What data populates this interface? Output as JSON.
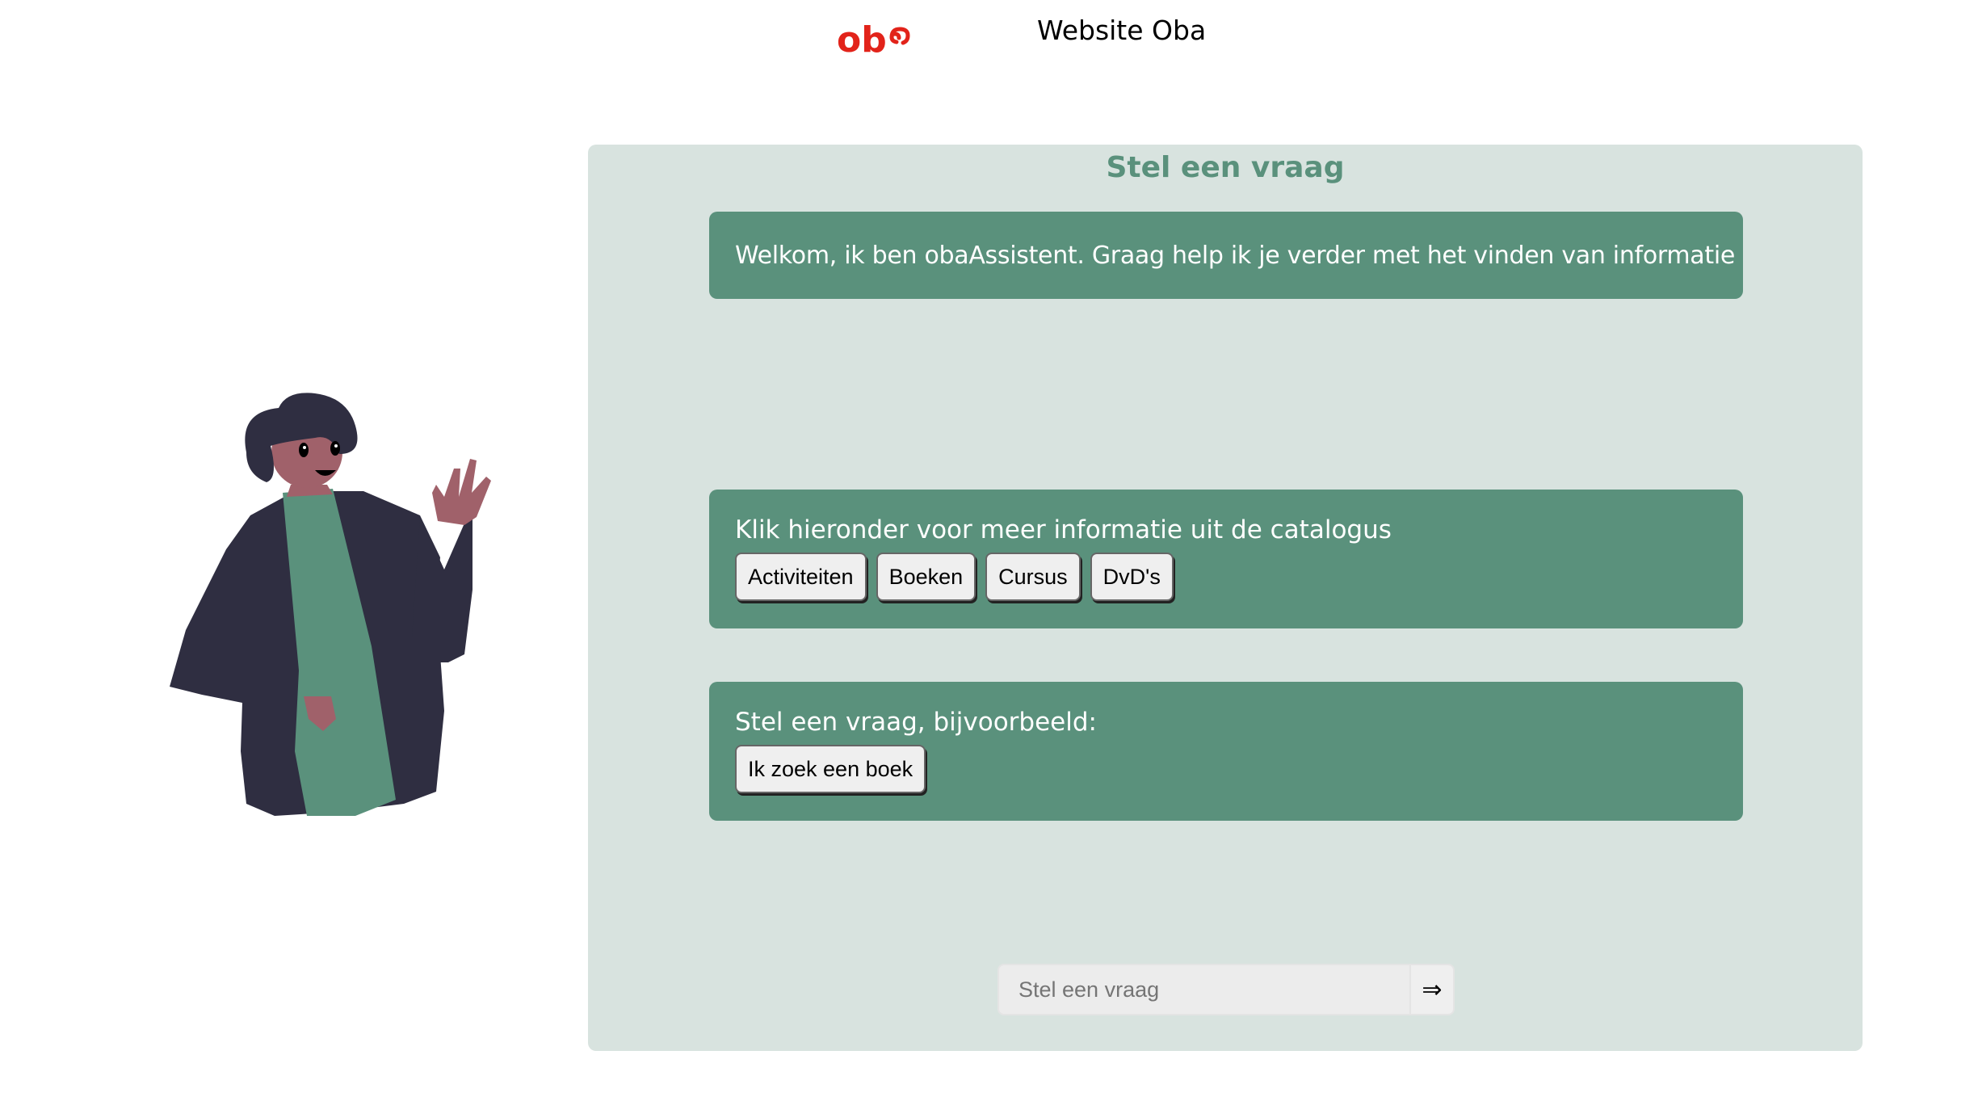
{
  "header": {
    "logo_text": "oba",
    "site_link": "Website Oba"
  },
  "chat": {
    "title": "Stel een vraag",
    "welcome": "Welkom, ik ben obaAssistent. Graag help ik je verder met het vinden van informatie",
    "catalog_prompt": "Klik hieronder voor meer informatie uit de catalogus",
    "catalog_buttons": [
      "Activiteiten",
      "Boeken",
      "Cursus",
      "DvD's"
    ],
    "example_prompt": "Stel een vraag, bijvoorbeeld:",
    "example_buttons": [
      "Ik zoek een boek"
    ],
    "input_placeholder": "Stel een vraag",
    "send_label": "⇒"
  },
  "colors": {
    "brand_red": "#e2231a",
    "accent_green": "#5a917c",
    "panel_bg": "#d8e3df"
  }
}
